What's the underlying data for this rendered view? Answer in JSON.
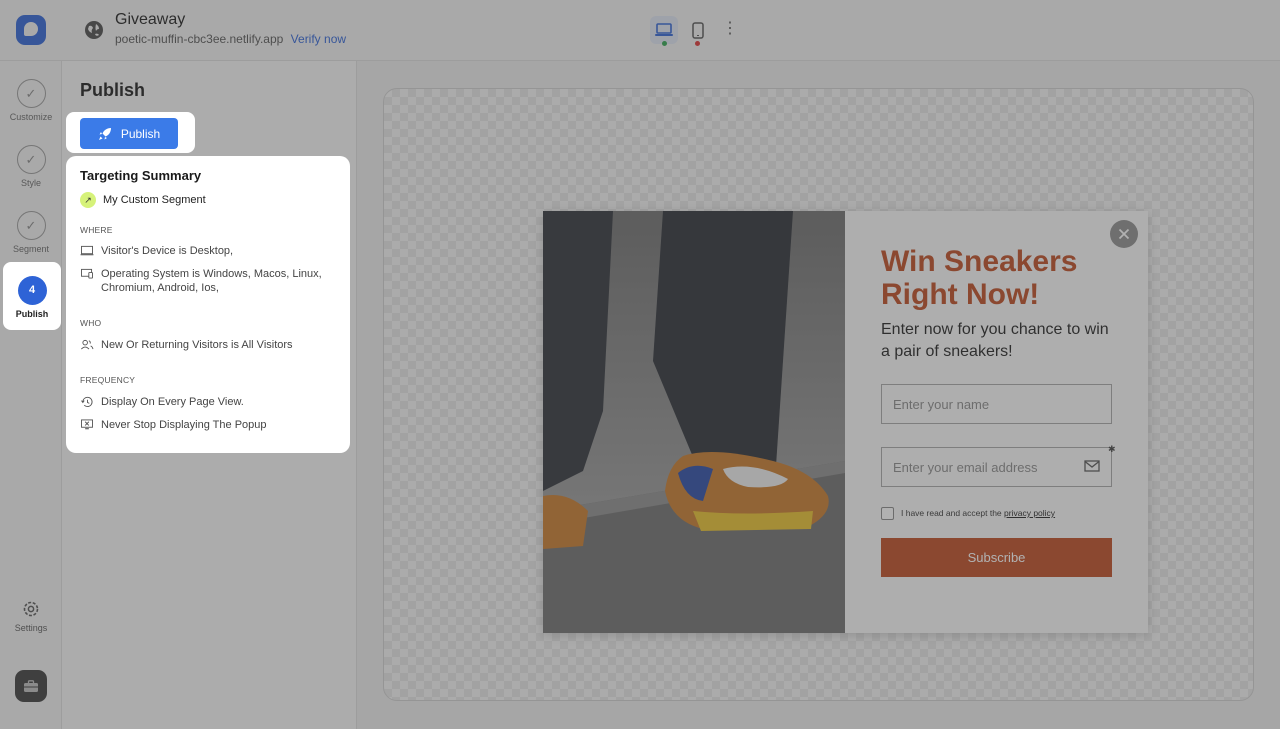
{
  "header": {
    "site_name": "Giveaway",
    "site_url": "poetic-muffin-cbc3ee.netlify.app",
    "verify_label": "Verify now",
    "kebab": "⋮"
  },
  "rail": {
    "items": [
      {
        "label": "Customize",
        "glyph": "✓"
      },
      {
        "label": "Style",
        "glyph": "✓"
      },
      {
        "label": "Segment",
        "glyph": "✓"
      }
    ],
    "active": {
      "number": "4",
      "label": "Publish"
    },
    "settings_label": "Settings"
  },
  "panel": {
    "title": "Publish",
    "publish_button": "Publish",
    "summary": {
      "title": "Targeting Summary",
      "segment": "My Custom Segment",
      "where_heading": "WHERE",
      "where_lines": [
        "Visitor's Device is Desktop,",
        "Operating System is Windows, Macos, Linux, Chromium, Android, Ios,"
      ],
      "who_heading": "WHO",
      "who_lines": [
        "New Or Returning Visitors is All Visitors"
      ],
      "frequency_heading": "FREQUENCY",
      "frequency_lines": [
        "Display On Every Page View.",
        "Never Stop Displaying The Popup"
      ]
    }
  },
  "popup": {
    "headline": "Win Sneakers Right Now!",
    "subheadline": "Enter now for you chance to win a pair of sneakers!",
    "name_placeholder": "Enter your name",
    "email_placeholder": "Enter your email address",
    "consent_text": "I have read and accept the",
    "privacy_link": "privacy policy",
    "subscribe_label": "Subscribe",
    "required_marker": "✱"
  },
  "colors": {
    "accent_blue": "#2e63d6",
    "publish_blue": "#3b7be8",
    "popup_accent": "#bd4b22",
    "status_green": "#2ea44f",
    "status_red": "#dd3333"
  }
}
